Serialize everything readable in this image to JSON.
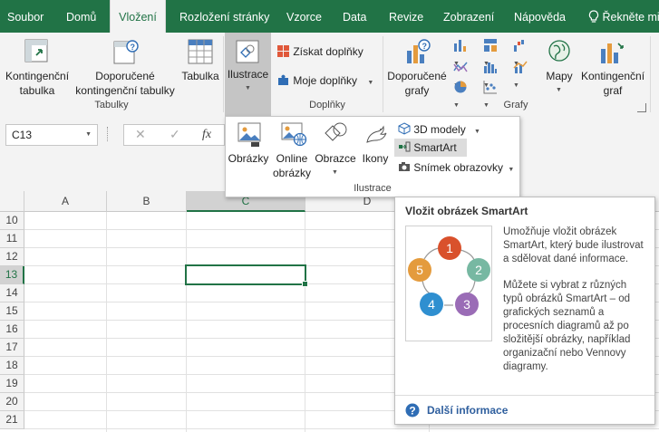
{
  "tabs": [
    "Soubor",
    "Domů",
    "Vložení",
    "Rozložení stránky",
    "Vzorce",
    "Data",
    "Revize",
    "Zobrazení",
    "Nápověda",
    "Řekněte mi"
  ],
  "active_tab": "Vložení",
  "ribbon": {
    "tabulky": {
      "pivot": [
        "Kontingenční",
        "tabulka"
      ],
      "recommended_pivot": [
        "Doporučené",
        "kontingenční tabulky"
      ],
      "table": "Tabulka",
      "group_label": "Tabulky"
    },
    "ilustrace_button": "Ilustrace",
    "doplnky": {
      "get_addins": "Získat doplňky",
      "my_addins": "Moje doplňky",
      "group_label": "Doplňky"
    },
    "grafy": {
      "recommended_charts": [
        "Doporučené",
        "grafy"
      ],
      "maps": "Mapy",
      "pivot_chart": [
        "Kontingenční",
        "graf"
      ],
      "group_label": "Grafy"
    }
  },
  "formula_bar": {
    "name_box": "C13",
    "cancel": "✕",
    "enter": "✓",
    "fx": "fx"
  },
  "illustrations_dropdown": {
    "pictures": "Obrázky",
    "online_pictures": [
      "Online",
      "obrázky"
    ],
    "shapes": "Obrazce",
    "icons": "Ikony",
    "models_3d": "3D modely",
    "smartart": "SmartArt",
    "screenshot": "Snímek obrazovky",
    "group_label": "Ilustrace"
  },
  "grid": {
    "columns": [
      "A",
      "B",
      "C",
      "D"
    ],
    "rows": [
      "10",
      "11",
      "12",
      "13",
      "14",
      "15",
      "16",
      "17",
      "18",
      "19",
      "20",
      "21"
    ],
    "selected_cell": "C13"
  },
  "tooltip": {
    "title": "Vložit obrázek SmartArt",
    "paragraph1": "Umožňuje vložit obrázek SmartArt, který bude ilustrovat a sdělovat dané informace.",
    "paragraph2": "Můžete si vybrat z různých typů obrázků SmartArt – od grafických seznamů a procesních diagramů až po složitější obrázky, například organizační nebo Vennovy diagramy.",
    "cycle_numbers": [
      "1",
      "2",
      "3",
      "4",
      "5"
    ],
    "more_info": "Další informace"
  },
  "colors": {
    "excel_green": "#217346",
    "cycle": [
      "#d9512c",
      "#77b8a2",
      "#9a6cb6",
      "#2f8fd0",
      "#e49b3d"
    ]
  }
}
